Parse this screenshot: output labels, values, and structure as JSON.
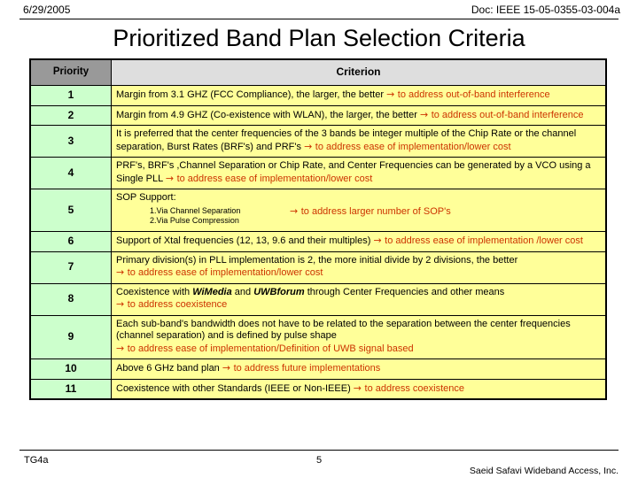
{
  "header": {
    "date": "6/29/2005",
    "doc": "Doc: IEEE 15-05-0355-03-004a"
  },
  "title": "Prioritized Band Plan Selection Criteria",
  "table": {
    "columns": {
      "priority": "Priority",
      "criterion": "Criterion"
    },
    "rows": [
      {
        "priority": "1",
        "text": "Margin from 3.1 GHZ (FCC Compliance), the larger, the better ",
        "arrow": "→ ",
        "note": "to address out-of-band interference"
      },
      {
        "priority": "2",
        "text": "Margin from 4.9 GHZ (Co-existence with WLAN), the larger, the better  ",
        "arrow": "→ ",
        "note": "to address out-of-band interference"
      },
      {
        "priority": "3",
        "text": "It is preferred that the center frequencies of the 3 bands be integer multiple of the Chip Rate or the channel separation, Burst Rates (BRF's) and PRF's ",
        "arrow": "→ ",
        "note": "to address ease of implementation/lower cost"
      },
      {
        "priority": "4",
        "text": "PRF's,  BRF's ,Channel Separation or Chip Rate, and Center Frequencies can be generated by a VCO using a Single PLL ",
        "arrow": "→ ",
        "note": "to address ease of implementation/lower cost"
      },
      {
        "priority": "5",
        "text": "SOP Support:",
        "sublist": [
          "1.Via Channel Separation",
          "2.Via Pulse Compression"
        ],
        "arrow": "→ ",
        "note": "to address larger number of SOP's"
      },
      {
        "priority": "6",
        "text": "Support of Xtal frequencies (12, 13, 9.6 and their multiples) ",
        "arrow": "→ ",
        "note": "to address ease of implementation /lower cost"
      },
      {
        "priority": "7",
        "text": "Primary division(s) in PLL implementation is 2, the more initial divide by 2 divisions, the better ",
        "arrow": "→ ",
        "note": "to address ease of implementation/lower cost"
      },
      {
        "priority": "8",
        "text_pre": "Coexistence with ",
        "emph1": "WiMedia",
        "text_mid": " and ",
        "emph2": "UWBforum",
        "text_post": " through Center Frequencies and other means ",
        "arrow": "→ ",
        "note": "to address coexistence"
      },
      {
        "priority": "9",
        "text": "Each sub-band's bandwidth does not have to be related to the separation between the center frequencies (channel separation) and is defined by pulse shape ",
        "arrow": "→ ",
        "note": "to address ease of implementation/Definition of UWB signal based"
      },
      {
        "priority": "10",
        "text": "Above 6 GHz band plan ",
        "arrow": "→ ",
        "note": "to address future implementations"
      },
      {
        "priority": "11",
        "text": "Coexistence with other Standards (IEEE or Non-IEEE) ",
        "arrow": "→ ",
        "note": "to address coexistence"
      }
    ]
  },
  "footer": {
    "left": "TG4a",
    "page": "5",
    "right": "Saeid Safavi Wideband Access, Inc."
  },
  "colors": {
    "priority_header_bg": "#999999",
    "criterion_header_bg": "#dedede",
    "priority_cell_bg": "#ccffcc",
    "criterion_cell_bg": "#ffff99",
    "annotation_red": "#cc3300"
  }
}
